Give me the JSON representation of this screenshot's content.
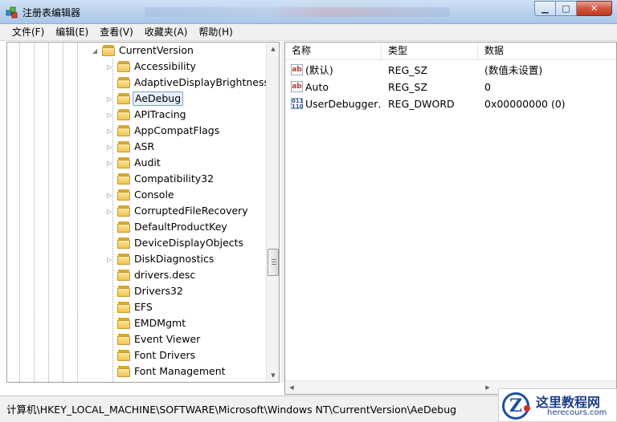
{
  "window": {
    "title": "注册表编辑器",
    "minimize_label": "▁",
    "maximize_label": "□",
    "close_label": "✕"
  },
  "menu": [
    "文件(F)",
    "编辑(E)",
    "查看(V)",
    "收藏夹(A)",
    "帮助(H)"
  ],
  "tree": {
    "parent": "CurrentVersion",
    "selected": "AeDebug",
    "items": [
      {
        "label": "Accessibility",
        "expandable": true
      },
      {
        "label": "AdaptiveDisplayBrightness",
        "expandable": false
      },
      {
        "label": "AeDebug",
        "expandable": true
      },
      {
        "label": "APITracing",
        "expandable": true
      },
      {
        "label": "AppCompatFlags",
        "expandable": true
      },
      {
        "label": "ASR",
        "expandable": true
      },
      {
        "label": "Audit",
        "expandable": true
      },
      {
        "label": "Compatibility32",
        "expandable": false
      },
      {
        "label": "Console",
        "expandable": true
      },
      {
        "label": "CorruptedFileRecovery",
        "expandable": true
      },
      {
        "label": "DefaultProductKey",
        "expandable": false
      },
      {
        "label": "DeviceDisplayObjects",
        "expandable": false
      },
      {
        "label": "DiskDiagnostics",
        "expandable": true
      },
      {
        "label": "drivers.desc",
        "expandable": false
      },
      {
        "label": "Drivers32",
        "expandable": false
      },
      {
        "label": "EFS",
        "expandable": false
      },
      {
        "label": "EMDMgmt",
        "expandable": false
      },
      {
        "label": "Event Viewer",
        "expandable": false
      },
      {
        "label": "Font Drivers",
        "expandable": false
      },
      {
        "label": "Font Management",
        "expandable": false
      }
    ]
  },
  "values_table": {
    "headers": {
      "name": "名称",
      "type": "类型",
      "data": "数据"
    },
    "rows": [
      {
        "name": "(默认)",
        "type": "REG_SZ",
        "data": "(数值未设置)",
        "icon": "string-value-icon"
      },
      {
        "name": "Auto",
        "type": "REG_SZ",
        "data": "0",
        "icon": "string-value-icon"
      },
      {
        "name": "UserDebugger…",
        "type": "REG_DWORD",
        "data": "0x00000000 (0)",
        "icon": "binary-value-icon"
      }
    ]
  },
  "status": {
    "path": "计算机\\HKEY_LOCAL_MACHINE\\SOFTWARE\\Microsoft\\Windows NT\\CurrentVersion\\AeDebug"
  },
  "watermark": {
    "logo_letter": "Z",
    "site_name": "这里教程网",
    "url": "herecours.com"
  },
  "colors": {
    "titlebar": "#bcd3ee",
    "close_button": "#c0391f",
    "selection_border": "#7da2ce",
    "folder": "#f0c34c"
  }
}
